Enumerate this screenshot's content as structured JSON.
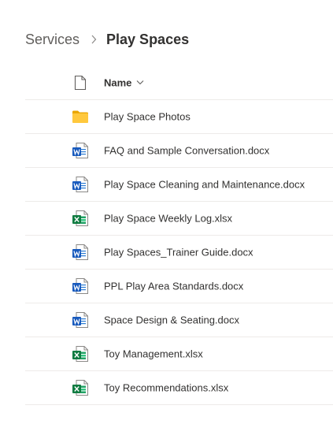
{
  "breadcrumb": {
    "parent": "Services",
    "current": "Play Spaces"
  },
  "list": {
    "column_name": "Name",
    "items": [
      {
        "name": "Play Space Photos",
        "type": "folder",
        "icon": "folder-icon"
      },
      {
        "name": "FAQ and Sample Conversation.docx",
        "type": "word",
        "icon": "word-doc-icon"
      },
      {
        "name": "Play Space Cleaning and Maintenance.docx",
        "type": "word",
        "icon": "word-doc-icon"
      },
      {
        "name": "Play Space Weekly Log.xlsx",
        "type": "excel",
        "icon": "excel-file-icon"
      },
      {
        "name": "Play Spaces_Trainer Guide.docx",
        "type": "word",
        "icon": "word-doc-icon"
      },
      {
        "name": "PPL Play Area Standards.docx",
        "type": "word",
        "icon": "word-doc-icon"
      },
      {
        "name": "Space Design & Seating.docx",
        "type": "word",
        "icon": "word-doc-icon"
      },
      {
        "name": "Toy Management.xlsx",
        "type": "excel",
        "icon": "excel-file-icon"
      },
      {
        "name": "Toy Recommendations.xlsx",
        "type": "excel",
        "icon": "excel-file-icon"
      }
    ]
  },
  "colors": {
    "word_blue": "#185abd",
    "excel_green": "#107c41",
    "folder_yellow": "#ffc83d",
    "divider": "#edebe9"
  }
}
